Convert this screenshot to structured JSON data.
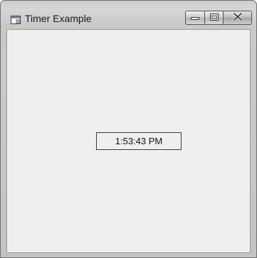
{
  "window": {
    "title": "Timer Example"
  },
  "icons": {
    "app": "app-window-icon",
    "minimize": "minimize-icon",
    "maximize": "maximize-icon",
    "close": "close-icon"
  },
  "timer": {
    "display": "1:53:43 PM"
  },
  "colors": {
    "client_background": "#efefef",
    "frame": "#c9c9c9",
    "label_border": "#3c3c3c"
  }
}
